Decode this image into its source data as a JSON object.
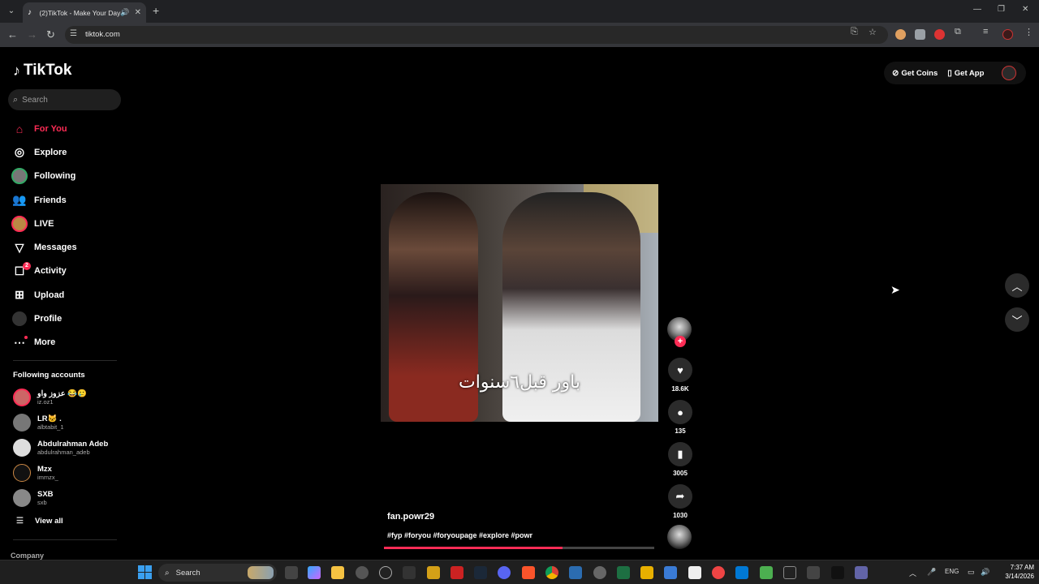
{
  "browser": {
    "tab_title": "(2)TikTok - Make Your Day",
    "url": "tiktok.com",
    "new_tab": "+",
    "win_minimize": "—",
    "win_restore": "❐",
    "win_close": "✕"
  },
  "sidebar": {
    "logo_text": "TikTok",
    "search_placeholder": "Search",
    "nav": [
      {
        "label": "For You",
        "icon": "home-icon"
      },
      {
        "label": "Explore",
        "icon": "compass-icon"
      },
      {
        "label": "Following",
        "icon": "following-avatar-icon"
      },
      {
        "label": "Friends",
        "icon": "friends-icon"
      },
      {
        "label": "LIVE",
        "icon": "live-icon"
      },
      {
        "label": "Messages",
        "icon": "messages-icon"
      },
      {
        "label": "Activity",
        "icon": "activity-icon",
        "badge": "2"
      },
      {
        "label": "Upload",
        "icon": "upload-icon"
      },
      {
        "label": "Profile",
        "icon": "profile-avatar-icon"
      },
      {
        "label": "More",
        "icon": "more-icon"
      }
    ],
    "following_heading": "Following accounts",
    "accounts": [
      {
        "name": "عزوز واو 😂🥲",
        "handle": "iz.oz1"
      },
      {
        "name": "LR🐱 .",
        "handle": "albtabit_1"
      },
      {
        "name": "Abdulrahman Adeb",
        "handle": "abdulrahman_adeb"
      },
      {
        "name": "Mzx",
        "handle": "immzx_"
      },
      {
        "name": "SXB",
        "handle": "sxb"
      }
    ],
    "view_all": "View all",
    "company": "Company"
  },
  "header": {
    "get_coins": "Get Coins",
    "get_app": "Get App"
  },
  "video": {
    "caption": "باور قبل٦سنوات",
    "author": "fan.powr29",
    "description": "#fyp #foryou #foryoupage #explore #powr",
    "progress": 0.66,
    "likes": "18.6K",
    "comments": "135",
    "saves": "3005",
    "shares": "1030"
  },
  "taskbar": {
    "search": "Search",
    "lang": "ENG",
    "time": "7:37 AM",
    "date": "3/14/2026"
  },
  "colors": {
    "accent": "#fe2c55",
    "background": "#000000"
  }
}
